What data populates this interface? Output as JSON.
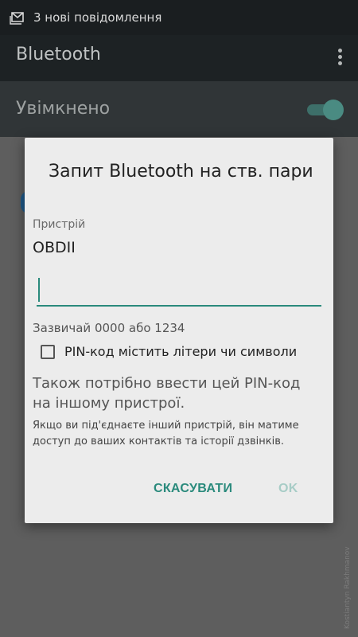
{
  "status_bar": {
    "notification_text": "3 нові повідомлення",
    "icon": "mail-stack-icon"
  },
  "app_bar": {
    "title": "Bluetooth",
    "overflow_icon": "more-vert-icon"
  },
  "toggle": {
    "label": "Увімкнено",
    "state": "on"
  },
  "dialog": {
    "title": "Запит Bluetooth на ств. пари",
    "device_label": "Пристрій",
    "device_name": "OBDII",
    "pin_input": {
      "value": "",
      "placeholder": ""
    },
    "hint": "Зазвичай 0000 або 1234",
    "checkbox_label": "PIN-код містить літери чи символи",
    "checkbox_checked": false,
    "info_large": "Також потрібно ввести цей PIN-код на іншому пристрої.",
    "info_small": "Якщо ви під'єднаєте інший пристрій, він матиме доступ до ваших контактів та історії дзвінків.",
    "cancel_label": "СКАСУВАТИ",
    "ok_label": "OK"
  },
  "watermark": "Kostiantyn Rakhmanov",
  "colors": {
    "accent": "#2a8a7c",
    "accent_disabled": "#a7ccc6",
    "dialog_bg": "#ececec"
  }
}
